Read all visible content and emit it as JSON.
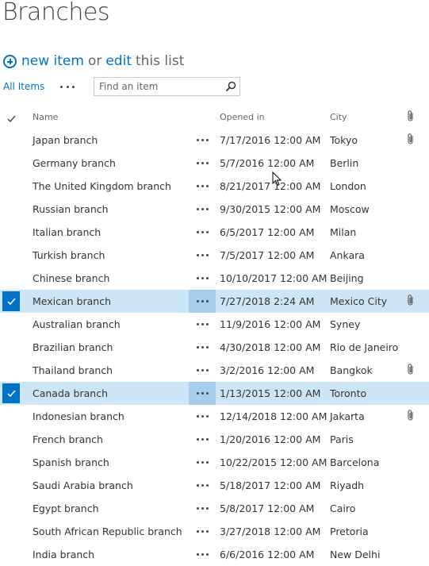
{
  "page": {
    "title": "Branches"
  },
  "commands": {
    "new_item_label": "new item",
    "or_label": "or",
    "edit_label": "edit",
    "this_list_label": "this list"
  },
  "view": {
    "current_view": "All Items"
  },
  "search": {
    "placeholder": "Find an item",
    "value": ""
  },
  "columns": {
    "name": "Name",
    "opened_in": "Opened in",
    "city": "City"
  },
  "icons": {
    "new_item": "plus-circle-icon",
    "search": "search-icon",
    "attachment": "paperclip-icon",
    "select_all": "checkmark-icon",
    "more": "ellipsis-icon"
  },
  "colors": {
    "accent": "#0072c6",
    "selected_row": "#cde6f7",
    "selected_menu": "#a6cdec"
  },
  "rows": [
    {
      "name": "Japan branch",
      "opened_in": "7/17/2016 12:00 AM",
      "city": "Tokyo",
      "has_attachment": true,
      "selected": false
    },
    {
      "name": "Germany branch",
      "opened_in": "5/7/2016 12:00 AM",
      "city": "Berlin",
      "has_attachment": false,
      "selected": false
    },
    {
      "name": "The United Kingdom branch",
      "opened_in": "8/21/2017 12:00 AM",
      "city": "London",
      "has_attachment": false,
      "selected": false
    },
    {
      "name": "Russian branch",
      "opened_in": "9/30/2015 12:00 AM",
      "city": "Moscow",
      "has_attachment": false,
      "selected": false
    },
    {
      "name": "Italian branch",
      "opened_in": "6/5/2017 12:00 AM",
      "city": "Milan",
      "has_attachment": false,
      "selected": false
    },
    {
      "name": "Turkish branch",
      "opened_in": "7/5/2017 12:00 AM",
      "city": "Ankara",
      "has_attachment": false,
      "selected": false
    },
    {
      "name": "Chinese branch",
      "opened_in": "10/10/2017 12:00 AM",
      "city": "Beijing",
      "has_attachment": false,
      "selected": false
    },
    {
      "name": "Mexican branch",
      "opened_in": "7/27/2018 2:24 AM",
      "city": "Mexico City",
      "has_attachment": true,
      "selected": true
    },
    {
      "name": "Australian branch",
      "opened_in": "11/9/2016 12:00 AM",
      "city": "Syney",
      "has_attachment": false,
      "selected": false
    },
    {
      "name": "Brazilian branch",
      "opened_in": "4/30/2018 12:00 AM",
      "city": "Rio de Janeiro",
      "has_attachment": false,
      "selected": false
    },
    {
      "name": "Thailand branch",
      "opened_in": "3/2/2016 12:00 AM",
      "city": "Bangkok",
      "has_attachment": true,
      "selected": false
    },
    {
      "name": "Canada branch",
      "opened_in": "1/13/2015 12:00 AM",
      "city": "Toronto",
      "has_attachment": false,
      "selected": true
    },
    {
      "name": "Indonesian branch",
      "opened_in": "12/14/2018 12:00 AM",
      "city": "Jakarta",
      "has_attachment": true,
      "selected": false
    },
    {
      "name": "French branch",
      "opened_in": "1/20/2016 12:00 AM",
      "city": "Paris",
      "has_attachment": false,
      "selected": false
    },
    {
      "name": "Spanish branch",
      "opened_in": "10/22/2015 12:00 AM",
      "city": "Barcelona",
      "has_attachment": false,
      "selected": false
    },
    {
      "name": "Saudi Arabia branch",
      "opened_in": "5/18/2017 12:00 AM",
      "city": "Riyadh",
      "has_attachment": false,
      "selected": false
    },
    {
      "name": "Egypt branch",
      "opened_in": "5/8/2017 12:00 AM",
      "city": "Cairo",
      "has_attachment": false,
      "selected": false
    },
    {
      "name": "South African Republic branch",
      "opened_in": "3/27/2018 12:00 AM",
      "city": "Pretoria",
      "has_attachment": false,
      "selected": false
    },
    {
      "name": "India branch",
      "opened_in": "6/6/2016 12:00 AM",
      "city": "New Delhi",
      "has_attachment": false,
      "selected": false
    }
  ]
}
